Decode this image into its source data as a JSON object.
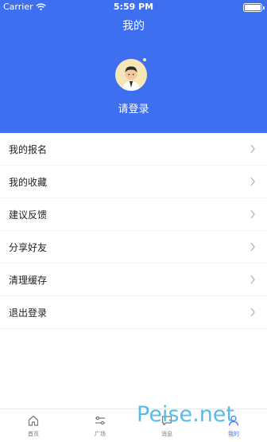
{
  "status_bar": {
    "carrier": "Carrier",
    "time": "5:59 PM"
  },
  "header": {
    "title": "我的",
    "login_prompt": "请登录"
  },
  "menu": [
    {
      "label": "我的报名"
    },
    {
      "label": "我的收藏"
    },
    {
      "label": "建议反馈"
    },
    {
      "label": "分享好友"
    },
    {
      "label": "清理缓存"
    },
    {
      "label": "退出登录"
    }
  ],
  "tabbar": {
    "tabs": [
      {
        "label": "首页",
        "icon": "home-icon",
        "active": false
      },
      {
        "label": "广场",
        "icon": "sliders-icon",
        "active": false
      },
      {
        "label": "消息",
        "icon": "message-icon",
        "active": false
      },
      {
        "label": "我的",
        "icon": "profile-icon",
        "active": true
      }
    ]
  },
  "watermark": "Peise.net",
  "colors": {
    "accent": "#3d6ff0",
    "watermark": "#49b7e8"
  }
}
